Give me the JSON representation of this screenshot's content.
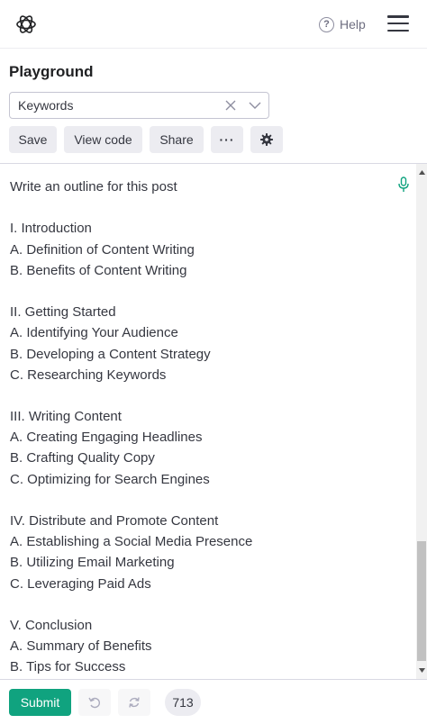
{
  "header": {
    "help_label": "Help",
    "help_icon_glyph": "?"
  },
  "playground": {
    "title": "Playground",
    "preset_select": {
      "value": "Keywords"
    },
    "buttons": {
      "save": "Save",
      "view_code": "View code",
      "share": "Share",
      "more": "···"
    }
  },
  "editor": {
    "lines": [
      "Write an outline for this post",
      "",
      "I. Introduction",
      "A. Definition of Content Writing",
      "B. Benefits of Content Writing",
      "",
      "II. Getting Started",
      "A. Identifying Your Audience",
      "B. Developing a Content Strategy",
      "C. Researching Keywords",
      "",
      "III. Writing Content",
      "A. Creating Engaging Headlines",
      "B. Crafting Quality Copy",
      "C. Optimizing for Search Engines",
      "",
      "IV. Distribute and Promote Content",
      "A. Establishing a Social Media Presence",
      "B. Utilizing Email Marketing",
      "C. Leveraging Paid Ads",
      "",
      "V. Conclusion",
      "A. Summary of Benefits",
      "B. Tips for Success"
    ]
  },
  "footer": {
    "submit": "Submit",
    "token_count": "713"
  },
  "colors": {
    "accent": "#10a37f",
    "button_bg": "#ececf1",
    "text": "#353740"
  },
  "icons": {
    "logo": "openai-logo-icon",
    "help": "help-circle-icon",
    "menu": "hamburger-menu-icon",
    "clear": "close-icon",
    "dropdown": "chevron-down-icon",
    "settings": "gear-icon",
    "mic": "microphone-icon",
    "undo": "undo-icon",
    "redo": "regenerate-icon"
  }
}
